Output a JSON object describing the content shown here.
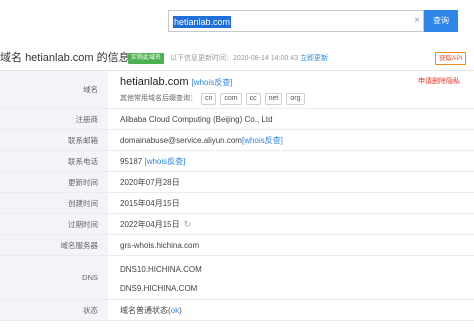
{
  "search": {
    "value": "hetianlab.com",
    "button_label": "查询"
  },
  "header": {
    "title_prefix": "域名",
    "domain": "hetianlab.com",
    "title_suffix": "的信息",
    "badge": "实购此域名",
    "update_text": "以下信息更新时间：2020-08-14 14:00:43",
    "refresh_link": "立即更新",
    "api_button": "获取API"
  },
  "rows": {
    "domain": {
      "label": "域名",
      "value": "hetianlab.com",
      "whois_link": "[whois反查]",
      "suffix_prompt": "其他常用域名后缀查询：",
      "suffixes": [
        "cn",
        "com",
        "cc",
        "net",
        "org"
      ],
      "privacy_link": "申请删除隐私"
    },
    "registrar": {
      "label": "注册商",
      "value": "Alibaba Cloud Computing (Beijing) Co., Ltd"
    },
    "email": {
      "label": "联系邮箱",
      "value": "domainabuse@service.aliyun.com",
      "whois_link": "[whois反查]"
    },
    "phone": {
      "label": "联系电话",
      "value": "95187",
      "whois_link": "[whois反查]"
    },
    "updated": {
      "label": "更新时间",
      "value": "2020年07月28日"
    },
    "created": {
      "label": "创建时间",
      "value": "2015年04月15日"
    },
    "expires": {
      "label": "过期时间",
      "value": "2022年04月15日"
    },
    "whois_server": {
      "label": "域名服务器",
      "value": "grs-whois.hichina.com"
    },
    "dns": {
      "label": "DNS",
      "values": [
        "DNS10.HICHINA.COM",
        "DNS9.HICHINA.COM"
      ]
    },
    "status": {
      "label": "状态",
      "value_prefix": "域名普通状态(",
      "value_link": "ok",
      "value_suffix": ")"
    }
  },
  "colors": {
    "accent": "#2e87e8",
    "badge": "#4caf50",
    "danger": "#e0392b",
    "label_bg": "#f3f4f7"
  }
}
